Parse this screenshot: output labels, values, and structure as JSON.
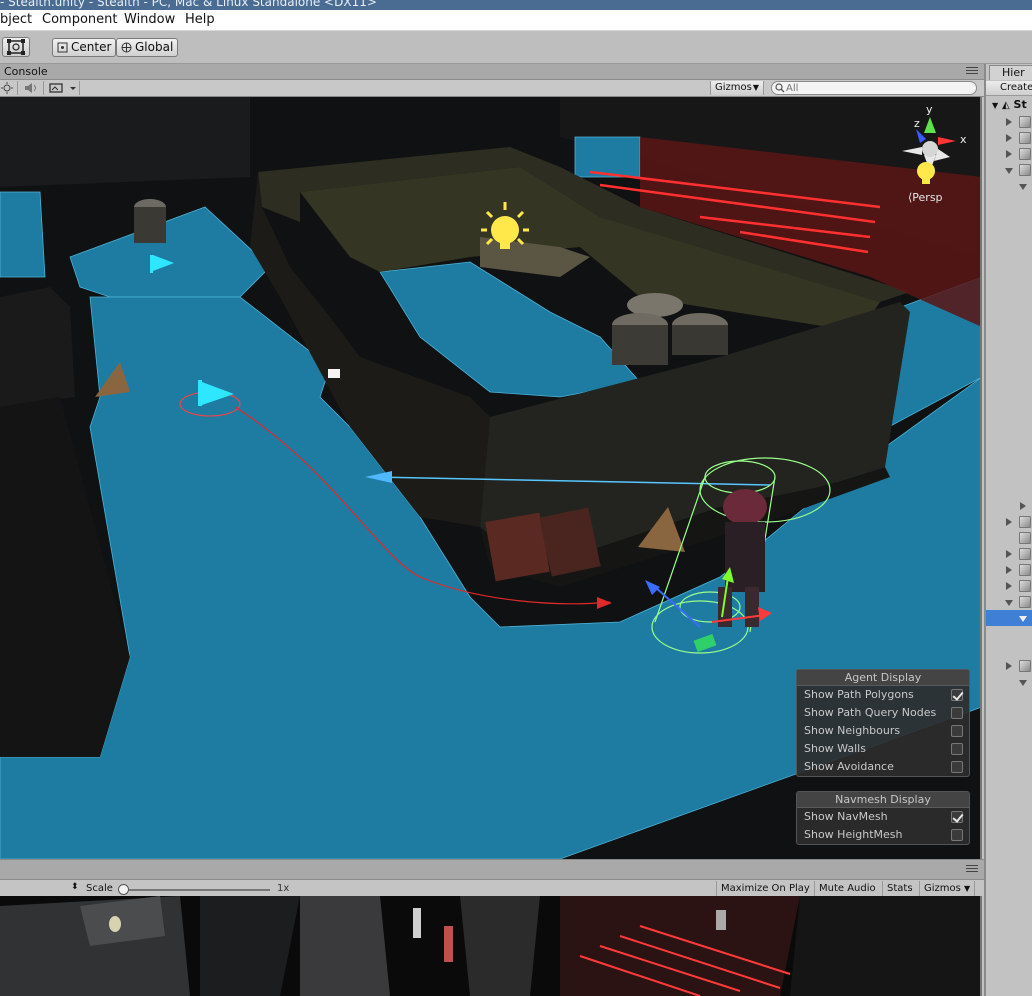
{
  "window": {
    "title": "- Stealth.unity - Stealth - PC, Mac & Linux Standalone <DX11>"
  },
  "menu": {
    "items": [
      "bject",
      "Component",
      "Window",
      "Help"
    ]
  },
  "toolbar": {
    "pivot_label": "Center",
    "space_label": "Global"
  },
  "scene_panel": {
    "tab_label": "Console",
    "gizmos_label": "Gizmos",
    "search_placeholder": "All",
    "projection_label": "Persp"
  },
  "agent_display": {
    "title": "Agent Display",
    "options": [
      {
        "label": "Show Path Polygons",
        "checked": true
      },
      {
        "label": "Show Path Query Nodes",
        "checked": false
      },
      {
        "label": "Show Neighbours",
        "checked": false
      },
      {
        "label": "Show Walls",
        "checked": false
      },
      {
        "label": "Show Avoidance",
        "checked": false
      }
    ]
  },
  "navmesh_display": {
    "title": "Navmesh Display",
    "options": [
      {
        "label": "Show NavMesh",
        "checked": true
      },
      {
        "label": "Show HeightMesh",
        "checked": false
      }
    ]
  },
  "game_panel": {
    "scale_label": "Scale",
    "scale_value": "1x",
    "scale_fraction": 0.0,
    "maximize_label": "Maximize On Play",
    "mute_label": "Mute Audio",
    "stats_label": "Stats",
    "gizmos_label": "Gizmos"
  },
  "hierarchy": {
    "tab_label": "Hier",
    "create_label": "Create",
    "root_label": "St"
  },
  "colors": {
    "navmesh": "#1f86b0",
    "selection": "#3f7fd6",
    "laser": "#ff3030"
  }
}
